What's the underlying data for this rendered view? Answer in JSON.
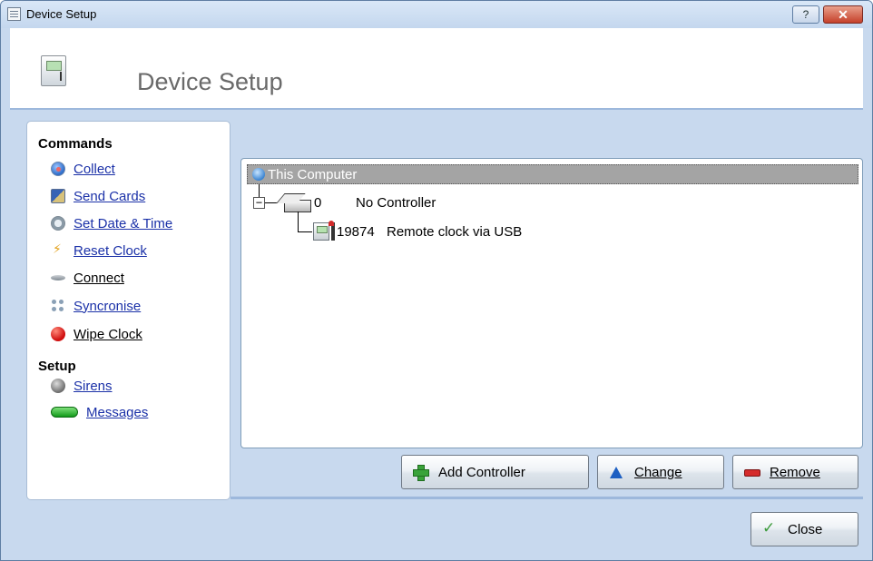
{
  "window": {
    "title": "Device Setup",
    "help_label": "?",
    "close_label": "✕"
  },
  "header": {
    "title": "Device Setup"
  },
  "sidebar": {
    "commands_heading": "Commands",
    "commands": [
      {
        "label": "Collect",
        "icon": "collect-icon"
      },
      {
        "label": "Send Cards",
        "icon": "send-cards-icon"
      },
      {
        "label": "Set Date & Time",
        "icon": "set-date-time-icon"
      },
      {
        "label": "Reset Clock",
        "icon": "reset-clock-icon"
      },
      {
        "label": "Connect",
        "icon": "connect-icon"
      },
      {
        "label": "Syncronise",
        "icon": "syncronise-icon"
      },
      {
        "label": "Wipe Clock",
        "icon": "wipe-clock-icon"
      }
    ],
    "setup_heading": "Setup",
    "setup": [
      {
        "label": "Sirens",
        "icon": "sirens-icon"
      },
      {
        "label": "Messages",
        "icon": "messages-icon"
      }
    ]
  },
  "tree": {
    "root_label": "This Computer",
    "controller": {
      "number": "0",
      "name": "No Controller",
      "expander": "−"
    },
    "clock": {
      "number": "19874",
      "name": "Remote clock via USB"
    }
  },
  "actions": {
    "add_controller": "Add Controller",
    "change": "Change",
    "remove": "Remove"
  },
  "footer": {
    "close_label": "Close"
  }
}
